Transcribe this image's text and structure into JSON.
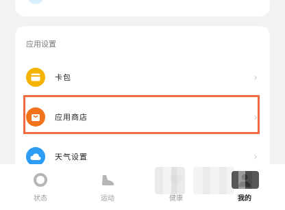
{
  "settings": {
    "section_title": "应用设置",
    "items": [
      {
        "label": "卡包",
        "icon": "wallet-icon",
        "color": "#f5b400"
      },
      {
        "label": "应用商店",
        "icon": "shopping-bag-icon",
        "color": "#f2721c"
      },
      {
        "label": "天气设置",
        "icon": "cloud-icon",
        "color": "#2c9df2"
      }
    ],
    "chevron": "›"
  },
  "tabbar": {
    "tabs": [
      {
        "label": "状态",
        "icon": "ring-icon"
      },
      {
        "label": "运动",
        "icon": "shoe-icon"
      },
      {
        "label": "健康",
        "icon": "heart-icon"
      },
      {
        "label": "我的",
        "icon": "person-icon",
        "active": true
      }
    ]
  },
  "colors": {
    "highlight": "#ef6a43",
    "background": "#f2f2f4"
  }
}
